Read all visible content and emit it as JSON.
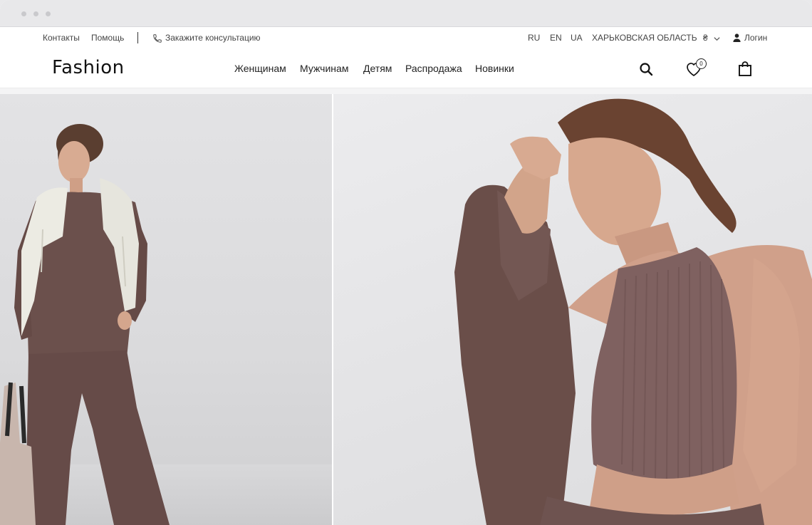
{
  "topbar": {
    "contacts": "Контакты",
    "help": "Помощь",
    "consult": "Закажите консультацию",
    "lang_ru": "RU",
    "lang_en": "EN",
    "lang_ua": "UA",
    "region": "ХАРЬКОВСКАЯ ОБЛАСТЬ",
    "currency": "₴",
    "login": "Логин"
  },
  "header": {
    "logo": "Fashion",
    "menu": [
      "Женщинам",
      "Мужчинам",
      "Детям",
      "Распродажа",
      "Новинки"
    ],
    "favorites_count": "0"
  },
  "icons": [
    "phone-icon",
    "chevron-down-icon",
    "user-icon",
    "search-icon",
    "heart-icon",
    "bag-icon"
  ],
  "colors": {
    "brand_text": "#111111",
    "outfit": "#6e5350",
    "background": "#ffffff"
  }
}
